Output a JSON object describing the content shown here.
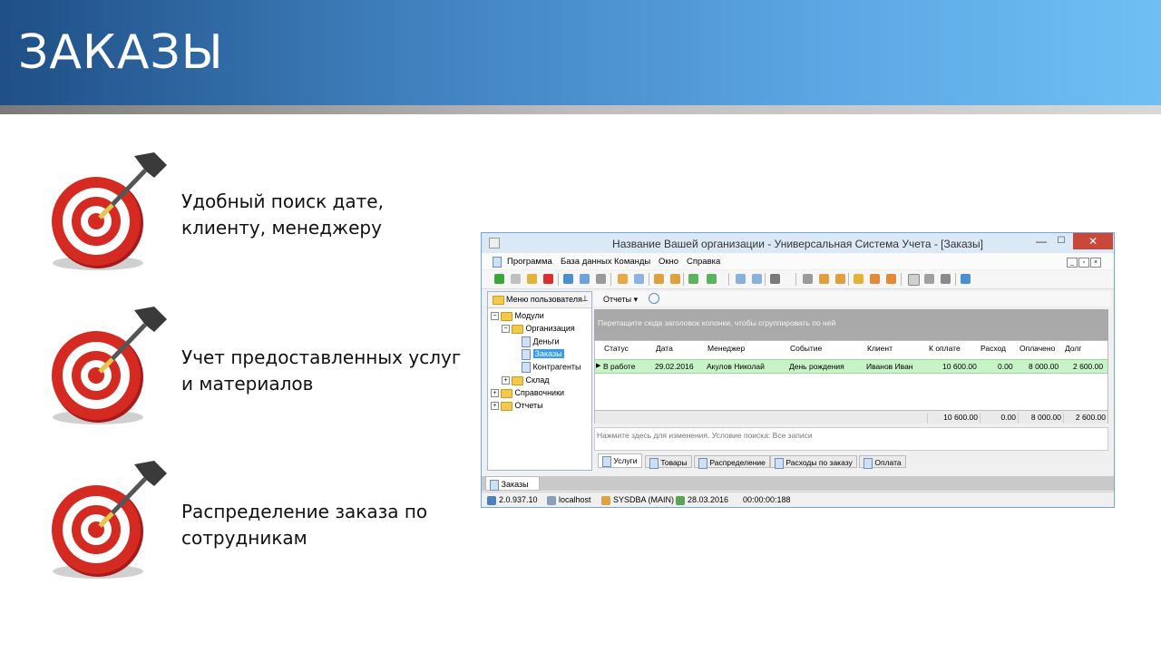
{
  "slide": {
    "title": "ЗАКАЗЫ",
    "features": [
      {
        "line1": "Удобный поиск дате,",
        "line2": "клиенту, менеджеру"
      },
      {
        "line1": "Учет предоставленных услуг",
        "line2": "и материалов"
      },
      {
        "line1": "Распределение заказа по",
        "line2": "сотрудникам"
      }
    ]
  },
  "window": {
    "title": "Название Вашей организации - Универсальная Система Учета - [Заказы]",
    "controls": {
      "minimize": "—",
      "maximize": "☐",
      "close": "✕"
    },
    "menu": [
      "Программа",
      "База данных",
      "Команды",
      "Окно",
      "Справка"
    ],
    "panel": {
      "title": "Меню пользователя",
      "tree": {
        "modules": "Модули",
        "org": "Организация",
        "money": "Деньги",
        "orders": "Заказы",
        "contractors": "Контрагенты",
        "warehouse": "Склад",
        "refs": "Справочники",
        "reports": "Отчеты"
      }
    },
    "reports_button": "Отчеты",
    "group_hint": "Перетащите сюда заголовок колонки, чтобы сгруппировать по ней",
    "columns": [
      "Статус",
      "Дата",
      "Менеджер",
      "Событие",
      "Клиент",
      "К оплате",
      "Расход",
      "Оплачено",
      "Долг"
    ],
    "row": {
      "status": "В работе",
      "date": "29.02.2016",
      "manager": "Акулов Николай",
      "event": "День рождения",
      "client": "Иванов Иван",
      "to_pay": "10 600.00",
      "expense": "0.00",
      "paid": "8 000.00",
      "debt": "2 600.00"
    },
    "totals": {
      "to_pay": "10 600.00",
      "expense": "0.00",
      "paid": "8 000.00",
      "debt": "2 600.00"
    },
    "filter_text": "Нажмите здесь для изменения. Условие поиска: Все записи",
    "tabs": [
      "Услуги",
      "Товары",
      "Распределение",
      "Расходы по заказу",
      "Оплата"
    ],
    "doc_tab": "Заказы",
    "status": {
      "version": "2.0.937.10",
      "host": "localhost",
      "user": "SYSDBA (MAIN)",
      "date": "28.03.2016",
      "timer": "00:00:00:188"
    }
  }
}
